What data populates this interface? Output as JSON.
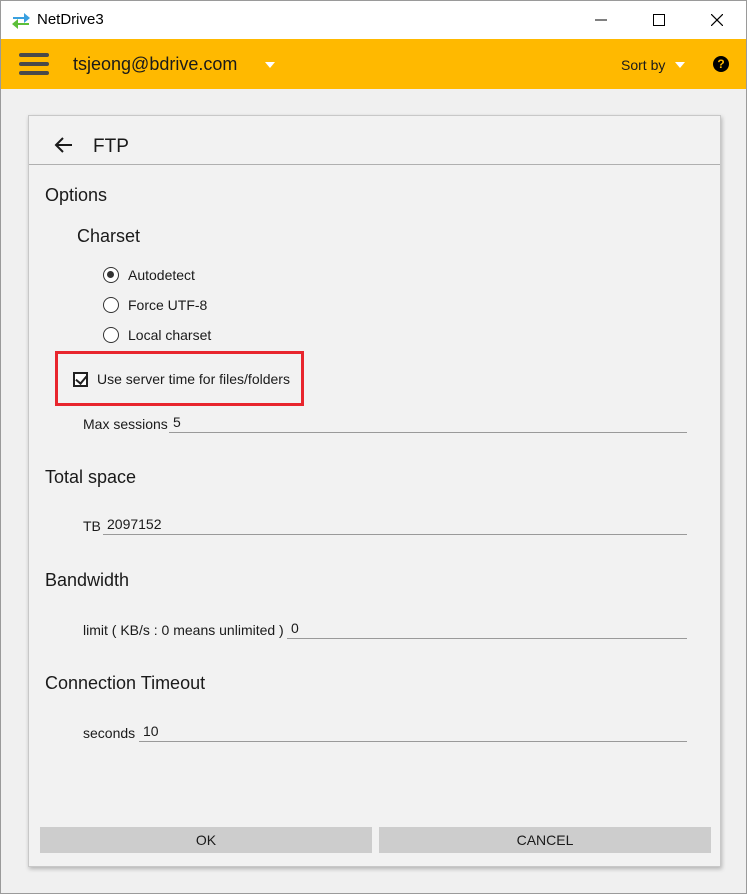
{
  "window": {
    "title": "NetDrive3"
  },
  "header": {
    "account": "tsjeong@bdrive.com",
    "sort_label": "Sort by",
    "help": "?"
  },
  "dialog": {
    "title": "FTP",
    "options": {
      "heading": "Options",
      "charset": {
        "heading": "Charset",
        "choices": [
          {
            "label": "Autodetect",
            "selected": true
          },
          {
            "label": "Force UTF-8",
            "selected": false
          },
          {
            "label": "Local charset",
            "selected": false
          }
        ]
      },
      "server_time": {
        "label": "Use server time for files/folders",
        "checked": true
      },
      "max_sessions": {
        "label": "Max sessions",
        "value": "5"
      }
    },
    "total_space": {
      "heading": "Total space",
      "label": "TB",
      "value": "2097152"
    },
    "bandwidth": {
      "heading": "Bandwidth",
      "label": "limit ( KB/s : 0 means unlimited )",
      "value": "0"
    },
    "timeout": {
      "heading": "Connection Timeout",
      "label": "seconds",
      "value": "10"
    },
    "buttons": {
      "ok": "OK",
      "cancel": "CANCEL"
    }
  },
  "colors": {
    "header": "#ffb900",
    "highlight": "#e8262d",
    "button": "#cdcdcd"
  }
}
